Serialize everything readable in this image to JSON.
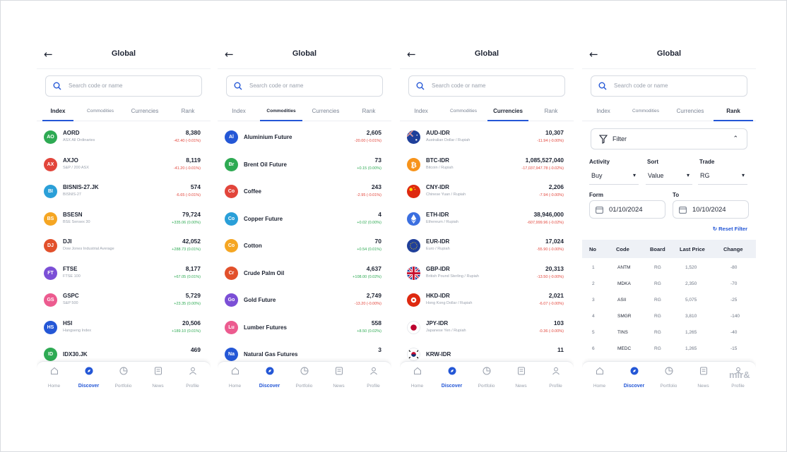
{
  "screen_title": "Global",
  "search_placeholder": "Search code or name",
  "tabs": [
    "Index",
    "Commodities",
    "Currencies",
    "Rank"
  ],
  "nav": [
    "Home",
    "Discover",
    "Portfolio",
    "News",
    "Profile"
  ],
  "colors": {
    "accent": "#2457d6",
    "negative": "#e2453b",
    "positive": "#2eaa53"
  },
  "index_rows": [
    {
      "code": "AORD",
      "abbr": "AO",
      "name": "ASX All Ordinaries",
      "price": "8,380",
      "change": "-42.40 (-0.01%)",
      "dir": "neg",
      "color": "#2eaa53"
    },
    {
      "code": "AXJO",
      "abbr": "AX",
      "name": "S&P / 200 ASX",
      "price": "8,119",
      "change": "-41.20 (-0.01%)",
      "dir": "neg",
      "color": "#e2453b"
    },
    {
      "code": "BISNIS-27.JK",
      "abbr": "BI",
      "name": "BISNIS-27",
      "price": "574",
      "change": "-6.65 (-0.01%)",
      "dir": "neg",
      "color": "#2a9fd8"
    },
    {
      "code": "BSESN",
      "abbr": "BS",
      "name": "BSE Sensex 30",
      "price": "79,724",
      "change": "+335.06 (0.00%)",
      "dir": "pos",
      "color": "#f5a623"
    },
    {
      "code": "DJI",
      "abbr": "DJ",
      "name": "Dow Jones Industrial Average",
      "price": "42,052",
      "change": "+288.73 (0.01%)",
      "dir": "pos",
      "color": "#e2502b"
    },
    {
      "code": "FTSE",
      "abbr": "FT",
      "name": "FTSE 100",
      "price": "8,177",
      "change": "+67.05 (0.01%)",
      "dir": "pos",
      "color": "#7b4fd6"
    },
    {
      "code": "GSPC",
      "abbr": "GS",
      "name": "S&P 500",
      "price": "5,729",
      "change": "+23.35 (0.00%)",
      "dir": "pos",
      "color": "#ec5b8f"
    },
    {
      "code": "HSI",
      "abbr": "HS",
      "name": "Hangseng Index",
      "price": "20,506",
      "change": "+189.10 (0.01%)",
      "dir": "pos",
      "color": "#2457d6"
    },
    {
      "code": "IDX30.JK",
      "abbr": "ID",
      "name": "",
      "price": "469",
      "change": "",
      "dir": "neg",
      "color": "#2eaa53"
    }
  ],
  "commodity_rows": [
    {
      "code": "Aluminium Future",
      "abbr": "Al",
      "price": "2,605",
      "change": "-20.00 (-0.01%)",
      "dir": "neg",
      "color": "#2457d6"
    },
    {
      "code": "Brent Oil Future",
      "abbr": "Br",
      "price": "73",
      "change": "+0.15 (0.00%)",
      "dir": "pos",
      "color": "#2eaa53"
    },
    {
      "code": "Coffee",
      "abbr": "Co",
      "price": "243",
      "change": "-2.95 (-0.01%)",
      "dir": "neg",
      "color": "#e2453b"
    },
    {
      "code": "Copper Future",
      "abbr": "Co",
      "price": "4",
      "change": "+0.02 (0.00%)",
      "dir": "pos",
      "color": "#2a9fd8"
    },
    {
      "code": "Cotton",
      "abbr": "Co",
      "price": "70",
      "change": "+0.54 (0.01%)",
      "dir": "pos",
      "color": "#f5a623"
    },
    {
      "code": "Crude Palm Oil",
      "abbr": "Cr",
      "price": "4,637",
      "change": "+108.00 (0.02%)",
      "dir": "pos",
      "color": "#e2502b"
    },
    {
      "code": "Gold Future",
      "abbr": "Go",
      "price": "2,749",
      "change": "-13.20 (-0.00%)",
      "dir": "neg",
      "color": "#7b4fd6"
    },
    {
      "code": "Lumber Futures",
      "abbr": "Lu",
      "price": "558",
      "change": "+8.50 (0.02%)",
      "dir": "pos",
      "color": "#ec5b8f"
    },
    {
      "code": "Natural Gas Futures",
      "abbr": "Na",
      "price": "3",
      "change": "",
      "dir": "neg",
      "color": "#2457d6"
    }
  ],
  "currency_rows": [
    {
      "code": "AUD-IDR",
      "name": "Australian Dollar / Rupiah",
      "price": "10,307",
      "change": "-11.94 (-0.00%)",
      "dir": "neg",
      "flag": "au"
    },
    {
      "code": "BTC-IDR",
      "name": "Bitcoin / Rupiah",
      "price": "1,085,527,040",
      "change": "-17,037,947.78 (-0.02%)",
      "dir": "neg",
      "flag": "btc"
    },
    {
      "code": "CNY-IDR",
      "name": "Chinese Yuan / Rupiah",
      "price": "2,206",
      "change": "-7.94 (-0.00%)",
      "dir": "neg",
      "flag": "cn"
    },
    {
      "code": "ETH-IDR",
      "name": "Ethereum / Rupiah",
      "price": "38,946,000",
      "change": "-607,999.96 (-0.02%)",
      "dir": "neg",
      "flag": "eth"
    },
    {
      "code": "EUR-IDR",
      "name": "Euro / Rupiah",
      "price": "17,024",
      "change": "-55.90 (-0.00%)",
      "dir": "neg",
      "flag": "eu"
    },
    {
      "code": "GBP-IDR",
      "name": "British Pound Sterling / Rupiah",
      "price": "20,313",
      "change": "-13.50 (-0.00%)",
      "dir": "neg",
      "flag": "gb"
    },
    {
      "code": "HKD-IDR",
      "name": "Hong Kong Dollar / Rupiah",
      "price": "2,021",
      "change": "-6.07 (-0.00%)",
      "dir": "neg",
      "flag": "hk"
    },
    {
      "code": "JPY-IDR",
      "name": "Japanese Yen / Rupiah",
      "price": "103",
      "change": "-0.36 (-0.00%)",
      "dir": "neg",
      "flag": "jp"
    },
    {
      "code": "KRW-IDR",
      "name": "",
      "price": "11",
      "change": "",
      "dir": "neg",
      "flag": "kr"
    }
  ],
  "rank": {
    "filter_label": "Filter",
    "activity_label": "Activity",
    "activity_value": "Buy",
    "sort_label": "Sort",
    "sort_value": "Value",
    "trade_label": "Trade",
    "trade_value": "RG",
    "from_label": "Form",
    "from_value": "01/10/2024",
    "to_label": "To",
    "to_value": "10/10/2024",
    "reset_label": "Reset Filter",
    "columns": [
      "No",
      "Code",
      "Board",
      "Last Price",
      "Change"
    ],
    "rows": [
      {
        "no": "1",
        "code": "ANTM",
        "board": "RG",
        "price": "1,520",
        "change": "-80"
      },
      {
        "no": "2",
        "code": "MDKA",
        "board": "RG",
        "price": "2,350",
        "change": "-70"
      },
      {
        "no": "3",
        "code": "ASII",
        "board": "RG",
        "price": "5,075",
        "change": "-25"
      },
      {
        "no": "4",
        "code": "SMGR",
        "board": "RG",
        "price": "3,810",
        "change": "-140"
      },
      {
        "no": "5",
        "code": "TINS",
        "board": "RG",
        "price": "1,265",
        "change": "-40"
      },
      {
        "no": "6",
        "code": "MEDC",
        "board": "RG",
        "price": "1,265",
        "change": "-15"
      }
    ]
  },
  "watermark": "mir&"
}
